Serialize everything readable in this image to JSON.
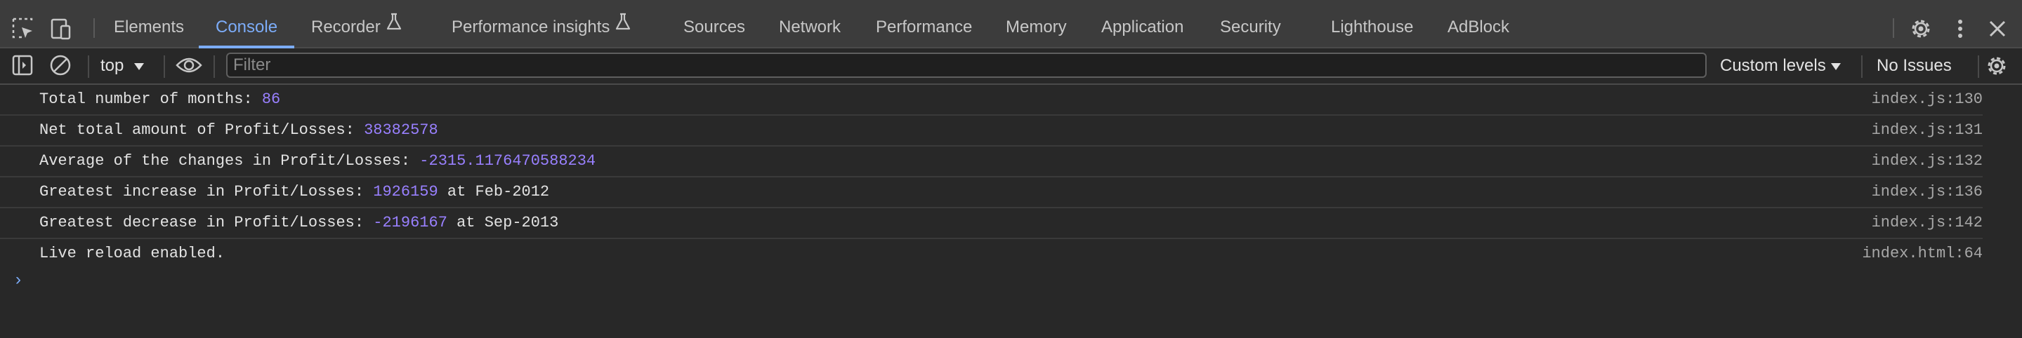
{
  "tabs": [
    {
      "label": "Elements"
    },
    {
      "label": "Console"
    },
    {
      "label": "Recorder"
    },
    {
      "label": "Performance insights"
    },
    {
      "label": "Sources"
    },
    {
      "label": "Network"
    },
    {
      "label": "Performance"
    },
    {
      "label": "Memory"
    },
    {
      "label": "Application"
    },
    {
      "label": "Security"
    },
    {
      "label": "Lighthouse"
    },
    {
      "label": "AdBlock"
    }
  ],
  "active_tab": "Console",
  "toolbar": {
    "context": "top",
    "filter_placeholder": "Filter",
    "filter_value": "",
    "levels": "Custom levels",
    "issues": "No Issues"
  },
  "console": {
    "rows": [
      {
        "text": "Total number of months: ",
        "value": "86",
        "suffix": "",
        "source": "index.js:130"
      },
      {
        "text": "Net total amount of Profit/Losses: ",
        "value": "38382578",
        "suffix": "",
        "source": "index.js:131"
      },
      {
        "text": "Average of the changes in Profit/Losses: ",
        "value": "-2315.1176470588234",
        "suffix": "",
        "source": "index.js:132"
      },
      {
        "text": "Greatest increase in Profit/Losses: ",
        "value": "1926159",
        "suffix": " at Feb-2012",
        "source": "index.js:136"
      },
      {
        "text": "Greatest decrease in Profit/Losses: ",
        "value": "-2196167",
        "suffix": " at Sep-2013",
        "source": "index.js:142"
      },
      {
        "text": "Live reload enabled.",
        "value": "",
        "suffix": "",
        "source": "index.html:64"
      }
    ],
    "prompt_symbol": "›"
  },
  "colors": {
    "accent": "#7cacf8",
    "number": "#9980ff",
    "background": "#282828",
    "tabbar": "#3c3c3c"
  }
}
